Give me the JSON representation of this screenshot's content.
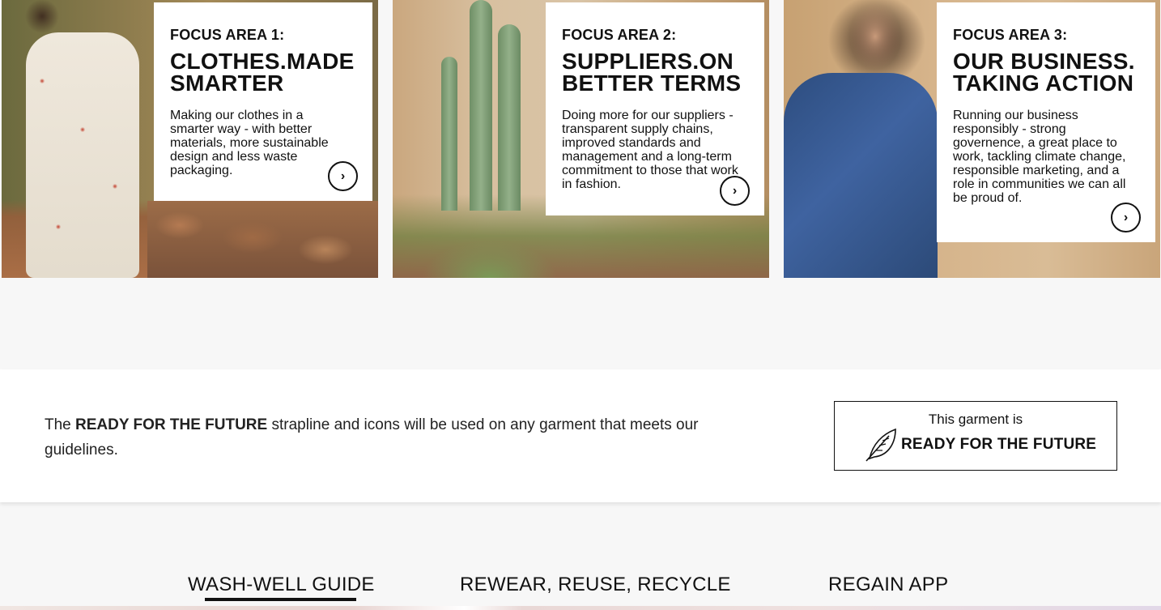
{
  "focus_areas": [
    {
      "kicker": "FOCUS AREA 1:",
      "title": "CLOTHES.MADE SMARTER",
      "description": "Making our clothes in a smarter way - with better materials, more sustainable design and less waste packaging.",
      "arrow": "›"
    },
    {
      "kicker": "FOCUS AREA 2:",
      "title": "SUPPLIERS.ON BETTER TERMS",
      "description": "Doing more for our suppliers - transparent supply chains, improved standards and management and a long-term commitment to those that work in fashion.",
      "arrow": "›"
    },
    {
      "kicker": "FOCUS AREA 3:",
      "title": "OUR BUSINESS. TAKING ACTION",
      "description": "Running our business responsibly - strong governence, a great place to work, tackling climate change, responsible marketing, and a role in communities we can all be proud of.",
      "arrow": "›"
    }
  ],
  "future_band": {
    "text_before": "The ",
    "text_bold": "READY FOR THE FUTURE",
    "text_after": " strapline and icons will be used on any garment that meets our guidelines.",
    "badge_top": "This garment is",
    "badge_main": "READY FOR THE FUTURE",
    "badge_icon": "leaf-icon"
  },
  "tabs": [
    {
      "label": "WASH-WELL GUIDE",
      "active": true
    },
    {
      "label": "REWEAR, REUSE, RECYCLE",
      "active": false
    },
    {
      "label": "REGAIN APP",
      "active": false
    }
  ]
}
